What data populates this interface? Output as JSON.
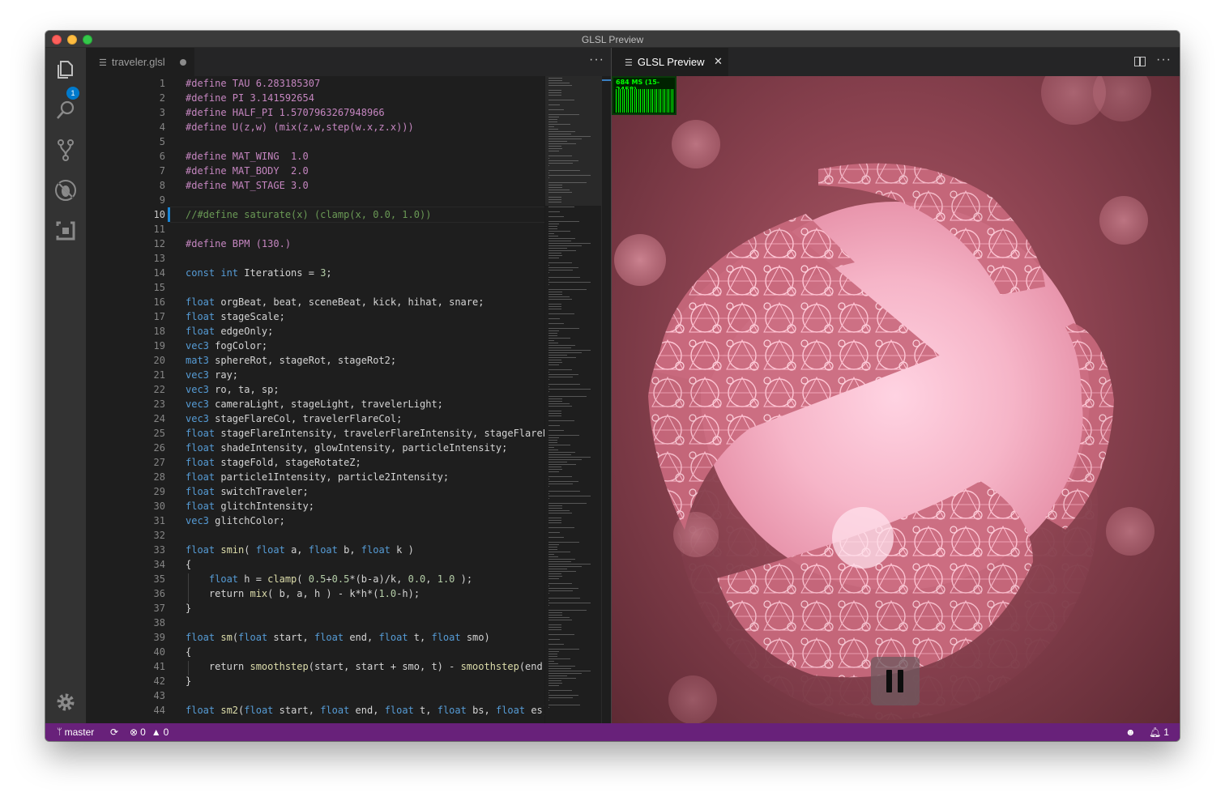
{
  "window": {
    "title": "GLSL Preview"
  },
  "activity_bar": {
    "explorer_badge": "1"
  },
  "editor": {
    "tab_label": "traveler.glsl",
    "active_line": 10,
    "lines": [
      [
        [
          "#define TAU 6.283185307",
          "pre"
        ]
      ],
      [
        [
          "#define PI 3.141592654",
          "pre"
        ]
      ],
      [
        [
          "#define HALF_PI 1.5707963267948966",
          "pre"
        ]
      ],
      [
        [
          "#define U(z,w) (mix(z,w,step(w.x,z.x)))",
          "pre"
        ]
      ],
      [],
      [
        [
          "#define MAT_WING  1.0",
          "pre"
        ]
      ],
      [
        [
          "#define MAT_BODY  2.0",
          "pre"
        ]
      ],
      [
        [
          "#define MAT_STAGE 3.0",
          "pre"
        ]
      ],
      [],
      [
        [
          "//#define saturate(x) (clamp(x, 0.0, 1.0))",
          "com"
        ]
      ],
      [],
      [
        [
          "#define BPM (130.)",
          "pre"
        ]
      ],
      [],
      [
        [
          "const int",
          "kw"
        ],
        [
          " Iterations = ",
          ""
        ],
        [
          "3",
          "num"
        ],
        [
          ";",
          ""
        ]
      ],
      [],
      [
        [
          "float",
          "kw"
        ],
        [
          " orgBeat, beat, sceneBeat, kick, hihat, snare;",
          ""
        ]
      ],
      [
        [
          "float",
          "kw"
        ],
        [
          " stageScale;",
          ""
        ]
      ],
      [
        [
          "float",
          "kw"
        ],
        [
          " edgeOnly;",
          ""
        ]
      ],
      [
        [
          "vec3",
          "kw"
        ],
        [
          " fogColor;",
          ""
        ]
      ],
      [
        [
          "mat3",
          "kw"
        ],
        [
          " sphereRot, stageRot, stageRot2;",
          ""
        ]
      ],
      [
        [
          "vec3",
          "kw"
        ],
        [
          " ray;",
          ""
        ]
      ],
      [
        [
          "vec3",
          "kw"
        ],
        [
          " ro, ta, sp;",
          ""
        ]
      ],
      [
        [
          "vec3",
          "kw"
        ],
        [
          " cameraLight, stageLight, travelerLight;",
          ""
        ]
      ],
      [
        [
          "vec3",
          "kw"
        ],
        [
          " stageFlareCol, travelerFlareCol;",
          ""
        ]
      ],
      [
        [
          "float",
          "kw"
        ],
        [
          " stageFlareIntensity, travelerFlareIntensity, stageFlareExp, tra",
          ""
        ]
      ],
      [
        [
          "float",
          "kw"
        ],
        [
          " shadeIntensity, glowIntensity, particleIntensity;",
          ""
        ]
      ],
      [
        [
          "float",
          "kw"
        ],
        [
          " stageFold, stageRotateZ;",
          ""
        ]
      ],
      [
        [
          "float",
          "kw"
        ],
        [
          " particle1Intensity, particle2Intensity;",
          ""
        ]
      ],
      [
        [
          "float",
          "kw"
        ],
        [
          " switchTraveler;",
          ""
        ]
      ],
      [
        [
          "float",
          "kw"
        ],
        [
          " glitchIntensity;",
          ""
        ]
      ],
      [
        [
          "vec3",
          "kw"
        ],
        [
          " glitchColor;",
          ""
        ]
      ],
      [],
      [
        [
          "float",
          "kw"
        ],
        [
          " ",
          ""
        ],
        [
          "smin",
          "fn"
        ],
        [
          "( ",
          ""
        ],
        [
          "float",
          "kw"
        ],
        [
          " a, ",
          ""
        ],
        [
          "float",
          "kw"
        ],
        [
          " b, ",
          ""
        ],
        [
          "float",
          "kw"
        ],
        [
          " k )",
          ""
        ]
      ],
      [
        [
          "{",
          ""
        ]
      ],
      [
        [
          "    ",
          ""
        ],
        [
          "float",
          "kw"
        ],
        [
          " h = ",
          ""
        ],
        [
          "clamp",
          "fn"
        ],
        [
          "( ",
          ""
        ],
        [
          "0.5",
          "num"
        ],
        [
          "+",
          ""
        ],
        [
          "0.5",
          "num"
        ],
        [
          "*(b-a)/k, ",
          ""
        ],
        [
          "0.0",
          "num"
        ],
        [
          ", ",
          ""
        ],
        [
          "1.0",
          "num"
        ],
        [
          " );",
          ""
        ]
      ],
      [
        [
          "    return ",
          ""
        ],
        [
          "mix",
          "fn"
        ],
        [
          "( b, a, h ) - k*h*(",
          ""
        ],
        [
          "1.0",
          "num"
        ],
        [
          "-h);",
          ""
        ]
      ],
      [
        [
          "}",
          ""
        ]
      ],
      [],
      [
        [
          "float",
          "kw"
        ],
        [
          " ",
          ""
        ],
        [
          "sm",
          "fn"
        ],
        [
          "(",
          ""
        ],
        [
          "float",
          "kw"
        ],
        [
          " start, ",
          ""
        ],
        [
          "float",
          "kw"
        ],
        [
          " end, ",
          ""
        ],
        [
          "float",
          "kw"
        ],
        [
          " t, ",
          ""
        ],
        [
          "float",
          "kw"
        ],
        [
          " smo)",
          ""
        ]
      ],
      [
        [
          "{",
          ""
        ]
      ],
      [
        [
          "    return ",
          ""
        ],
        [
          "smoothstep",
          "fn"
        ],
        [
          "(start, start + smo, t) - ",
          ""
        ],
        [
          "smoothstep",
          "fn"
        ],
        [
          "(end - smo, ",
          ""
        ]
      ],
      [
        [
          "}",
          ""
        ]
      ],
      [],
      [
        [
          "float",
          "kw"
        ],
        [
          " ",
          ""
        ],
        [
          "sm2",
          "fn"
        ],
        [
          "(",
          ""
        ],
        [
          "float",
          "kw"
        ],
        [
          " start, ",
          ""
        ],
        [
          "float",
          "kw"
        ],
        [
          " end, ",
          ""
        ],
        [
          "float",
          "kw"
        ],
        [
          " t, ",
          ""
        ],
        [
          "float",
          "kw"
        ],
        [
          " bs, ",
          ""
        ],
        [
          "float",
          "kw"
        ],
        [
          " es)",
          ""
        ]
      ]
    ]
  },
  "preview": {
    "tab_label": "GLSL Preview",
    "close_glyph": "✕",
    "more_glyph": "···",
    "stats_text": "684 MS (15-2458)",
    "pause_icon": "pause-icon"
  },
  "statusbar": {
    "branch": "master",
    "errors": "0",
    "warnings": "0",
    "notifications": "1",
    "color": "#68217a"
  },
  "colors": {
    "keyword": "#569cd6",
    "preprocessor": "#c586c0",
    "function": "#dcdcaa",
    "number": "#b5cea8",
    "comment": "#6a9955",
    "accent": "#007acc"
  }
}
